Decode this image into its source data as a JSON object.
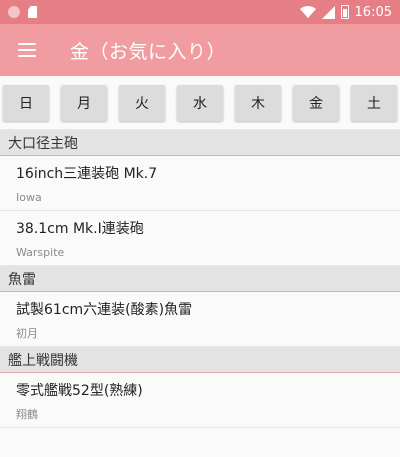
{
  "status_bar": {
    "time": "16:05",
    "icons": [
      "notification-circle-icon",
      "sd-card-icon",
      "wifi-icon",
      "signal-icon",
      "battery-icon"
    ]
  },
  "app_bar": {
    "title": "金（お気に入り）",
    "background": "#f19ca1",
    "status_color": "#e67f85"
  },
  "days": [
    "日",
    "月",
    "火",
    "水",
    "木",
    "金",
    "土"
  ],
  "sections": [
    {
      "header": "大口径主砲",
      "items": [
        {
          "name": "16inch三連装砲 Mk.7",
          "ship": "Iowa"
        },
        {
          "name": "38.1cm Mk.I連装砲",
          "ship": "Warspite"
        }
      ]
    },
    {
      "header": "魚雷",
      "items": [
        {
          "name": "試製61cm六連装(酸素)魚雷",
          "ship": "初月"
        }
      ]
    },
    {
      "header": "艦上戦闘機",
      "items": [
        {
          "name": "零式艦戦52型(熟練)",
          "ship": "翔鶴"
        }
      ]
    }
  ]
}
